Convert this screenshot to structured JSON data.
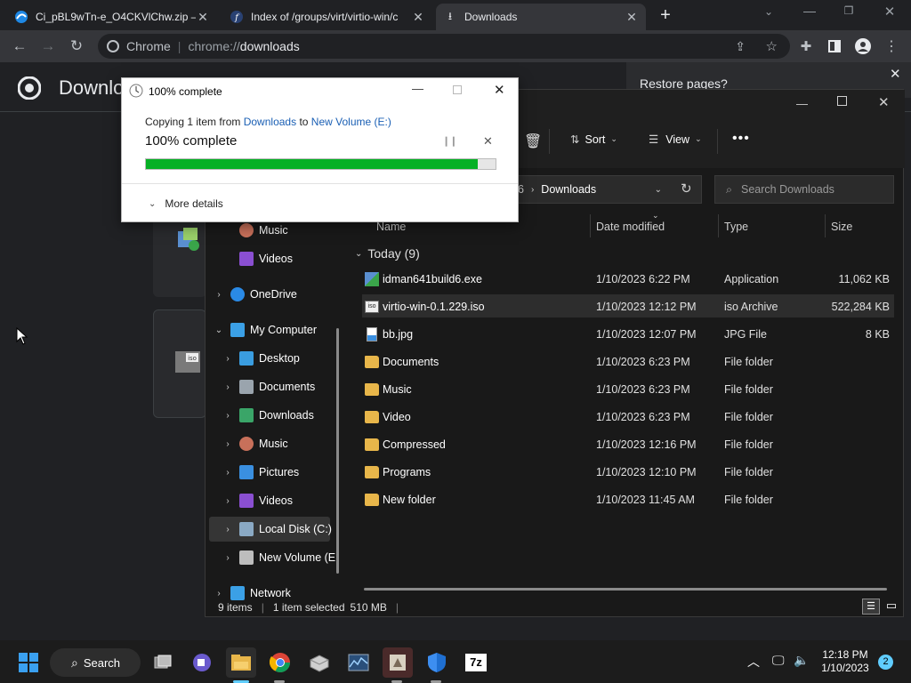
{
  "tabs": [
    {
      "label": "Ci_pBL9wTn-e_O4CKVlChw.zip —",
      "icon": "edge-icon"
    },
    {
      "label": "Index of /groups/virt/virtio-win/c",
      "icon": "fedora-icon"
    },
    {
      "label": "Downloads",
      "icon": "download-icon"
    }
  ],
  "omnibox": {
    "site": "Chrome",
    "url_prefix": "chrome://",
    "url_path": "downloads"
  },
  "chrome_page": {
    "title": "Downlo",
    "restore_text": "Restore pages?"
  },
  "dialog": {
    "title": "100% complete",
    "copy_prefix": "Copying 1 item from",
    "source": "Downloads",
    "to_word": "to",
    "dest": "New Volume (E:)",
    "percent_text": "100% complete",
    "progress": 0.95,
    "more_details": "More details"
  },
  "explorer": {
    "toolbar": {
      "sort": "Sort",
      "view": "View"
    },
    "path_tail": "6",
    "path_current": "Downloads",
    "search_placeholder": "Search Downloads",
    "columns": {
      "name": "Name",
      "date": "Date modified",
      "type": "Type",
      "size": "Size"
    },
    "group_label": "Today (9)",
    "files": [
      {
        "name": "idman641build6.exe",
        "date": "1/10/2023 6:22 PM",
        "type": "Application",
        "size": "11,062 KB",
        "icon": "exe-icon"
      },
      {
        "name": "virtio-win-0.1.229.iso",
        "date": "1/10/2023 12:12 PM",
        "type": "iso Archive",
        "size": "522,284 KB",
        "icon": "iso-icon"
      },
      {
        "name": "bb.jpg",
        "date": "1/10/2023 12:07 PM",
        "type": "JPG File",
        "size": "8 KB",
        "icon": "image-file-icon"
      },
      {
        "name": "Documents",
        "date": "1/10/2023 6:23 PM",
        "type": "File folder",
        "size": "",
        "icon": "folder-icon"
      },
      {
        "name": "Music",
        "date": "1/10/2023 6:23 PM",
        "type": "File folder",
        "size": "",
        "icon": "folder-icon"
      },
      {
        "name": "Video",
        "date": "1/10/2023 6:23 PM",
        "type": "File folder",
        "size": "",
        "icon": "folder-icon"
      },
      {
        "name": "Compressed",
        "date": "1/10/2023 12:16 PM",
        "type": "File folder",
        "size": "",
        "icon": "folder-icon"
      },
      {
        "name": "Programs",
        "date": "1/10/2023 12:10 PM",
        "type": "File folder",
        "size": "",
        "icon": "folder-icon"
      },
      {
        "name": "New folder",
        "date": "1/10/2023 11:45 AM",
        "type": "File folder",
        "size": "",
        "icon": "folder-icon"
      }
    ],
    "nav": [
      {
        "label": "Music",
        "color": "#c8705a",
        "level": 1
      },
      {
        "label": "Videos",
        "color": "#8a4fd1",
        "level": 1
      },
      {
        "label": "OneDrive",
        "color": "#2a8ae6",
        "level": 0
      },
      {
        "label": "My Computer",
        "color": "#3ba0e6",
        "level": 0
      },
      {
        "label": "Desktop",
        "color": "#3a9de0",
        "level": 1
      },
      {
        "label": "Documents",
        "color": "#9aa4ad",
        "level": 1
      },
      {
        "label": "Downloads",
        "color": "#3aa568",
        "level": 1
      },
      {
        "label": "Music",
        "color": "#c8705a",
        "level": 1
      },
      {
        "label": "Pictures",
        "color": "#3a8fe0",
        "level": 1
      },
      {
        "label": "Videos",
        "color": "#8a4fd1",
        "level": 1
      },
      {
        "label": "Local Disk (C:)",
        "color": "#8aa9c4",
        "level": 1
      },
      {
        "label": "New Volume (E",
        "color": "#bdbdbd",
        "level": 1
      },
      {
        "label": "Network",
        "color": "#3ba0e6",
        "level": 0
      }
    ],
    "status": {
      "items": "9 items",
      "selected": "1 item selected",
      "size": "510 MB"
    }
  },
  "taskbar": {
    "search": "Search",
    "time": "12:18 PM",
    "date": "1/10/2023",
    "notif_count": "2"
  }
}
